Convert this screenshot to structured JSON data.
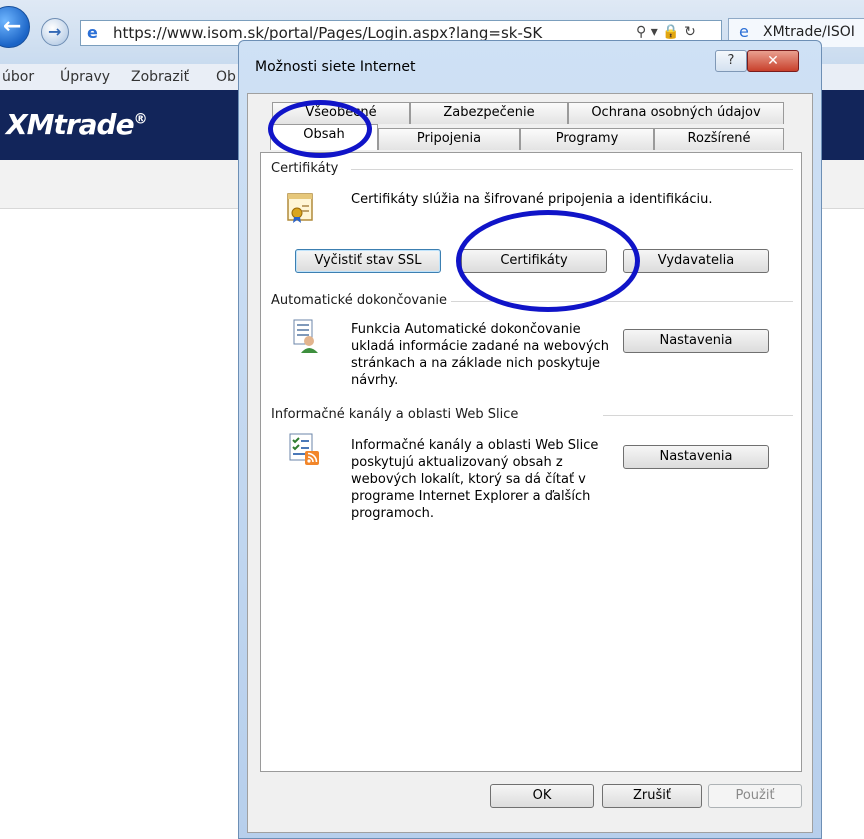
{
  "browser": {
    "address_url": "https://www.isom.sk/portal/Pages/Login.aspx?lang=sk-SK",
    "address_tools": "⚲ ▾ 🔒 ↻",
    "tab_title": "XMtrade/ISOI",
    "menu": [
      "úbor",
      "Úpravy",
      "Zobraziť",
      "Ob"
    ]
  },
  "site": {
    "logo": "XMtrade",
    "logo_mark": "®"
  },
  "dialog": {
    "title": "Možnosti siete Internet",
    "help_label": "?",
    "close_label": "✕",
    "tabs_back": [
      "Všeobecné",
      "Zabezpečenie",
      "Ochrana osobných údajov"
    ],
    "tabs_front": [
      "Obsah",
      "Pripojenia",
      "Programy",
      "Rozšírené"
    ],
    "active_tab": "Obsah",
    "certificates": {
      "title": "Certifikáty",
      "description": "Certifikáty slúžia na šifrované pripojenia a identifikáciu.",
      "clear_ssl_label": "Vyčistiť stav SSL",
      "certificates_label": "Certifikáty",
      "publishers_label": "Vydavatelia"
    },
    "autocomplete": {
      "title": "Automatické dokončovanie",
      "description": "Funkcia Automatické dokončovanie ukladá informácie zadané na webových stránkach a na základe nich poskytuje návrhy.",
      "settings_label": "Nastavenia"
    },
    "feeds": {
      "title": "Informačné kanály a oblasti Web Slice",
      "description": "Informačné kanály a oblasti Web Slice poskytujú aktualizovaný obsah z webových lokalít, ktorý sa dá čítať v programe Internet Explorer a ďalších programoch.",
      "settings_label": "Nastavenia"
    },
    "ok_label": "OK",
    "cancel_label": "Zrušiť",
    "apply_label": "Použiť"
  }
}
